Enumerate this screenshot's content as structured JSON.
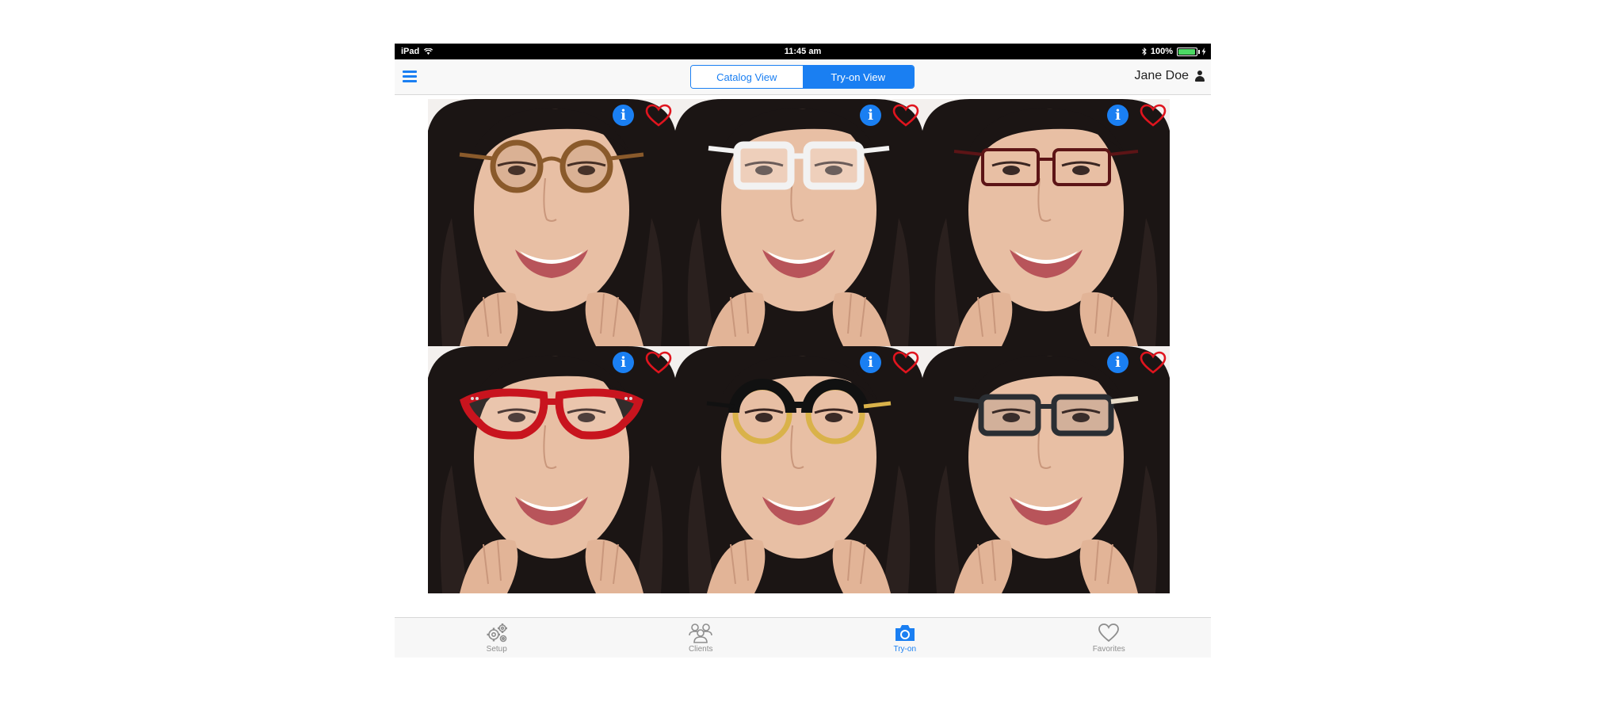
{
  "status_bar": {
    "device": "iPad",
    "time": "11:45 am",
    "battery": "100%"
  },
  "nav": {
    "segments": [
      {
        "label": "Catalog View",
        "selected": false
      },
      {
        "label": "Try-on View",
        "selected": true
      }
    ],
    "user_name": "Jane Doe"
  },
  "tiles": [
    {
      "frame": "tortoise round",
      "frame_color": "#8a5a2b"
    },
    {
      "frame": "clear square",
      "frame_color": "#f2f2f2"
    },
    {
      "frame": "thin burgundy rectangle",
      "frame_color": "#5c1416"
    },
    {
      "frame": "red cat-eye",
      "frame_color": "#c8141e"
    },
    {
      "frame": "black over yellow round",
      "frame_color": "#111111"
    },
    {
      "frame": "dark grey rectangle",
      "frame_color": "#2a2e33"
    }
  ],
  "tab_bar": {
    "tabs": [
      {
        "label": "Setup",
        "icon": "gears-icon",
        "active": false
      },
      {
        "label": "Clients",
        "icon": "clients-icon",
        "active": false
      },
      {
        "label": "Try-on",
        "icon": "camera-icon",
        "active": true
      },
      {
        "label": "Favorites",
        "icon": "heart-icon",
        "active": false
      }
    ]
  },
  "colors": {
    "accent": "#1a7ff2",
    "favorite": "#e0141e"
  }
}
